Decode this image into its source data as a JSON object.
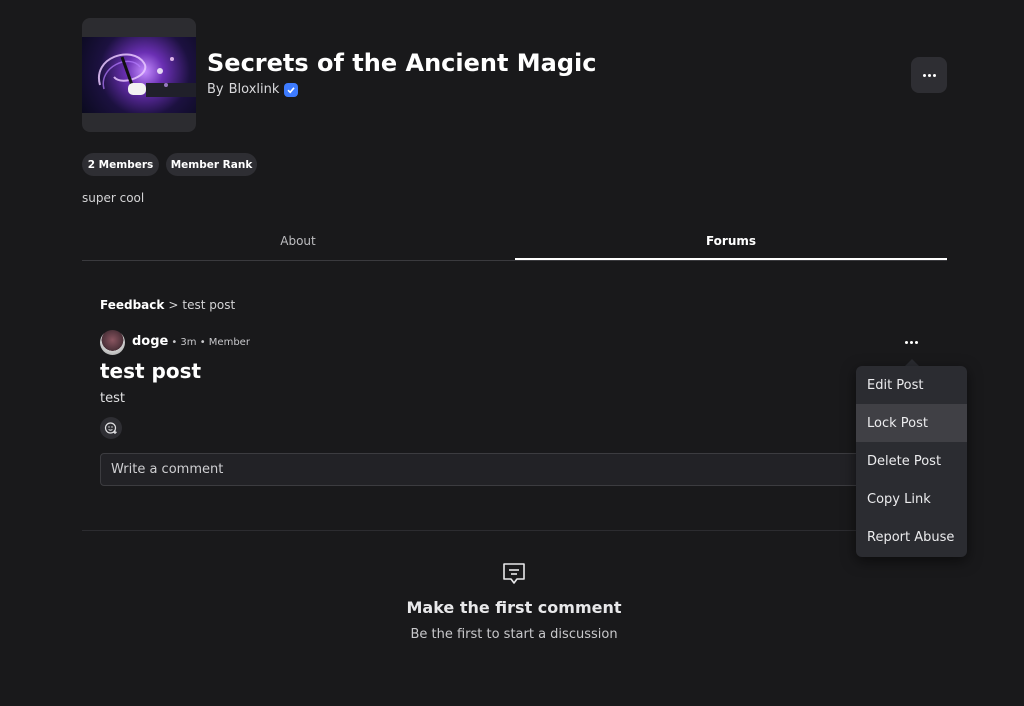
{
  "group": {
    "title": "Secrets of the Ancient Magic",
    "owner_prefix": "By",
    "owner_name": "Bloxlink",
    "members_label": "2 Members",
    "rank_label": "Member Rank",
    "description": "super cool",
    "verified_icon": "verified-badge-icon",
    "accent_color": "#3d7bff"
  },
  "tabs": [
    {
      "label": "About",
      "active": false
    },
    {
      "label": "Forums",
      "active": true
    }
  ],
  "breadcrumb": {
    "category": "Feedback",
    "separator": ">",
    "current": "test post"
  },
  "post": {
    "author": "doge",
    "meta": "• 3m • Member",
    "title": "test post",
    "body": "test",
    "comment_placeholder": "Write a comment"
  },
  "menu": {
    "items": [
      "Edit Post",
      "Lock Post",
      "Delete Post",
      "Copy Link",
      "Report Abuse"
    ],
    "highlighted": "Lock Post"
  },
  "empty_state": {
    "title": "Make the first comment",
    "subtitle": "Be the first to start a discussion"
  }
}
